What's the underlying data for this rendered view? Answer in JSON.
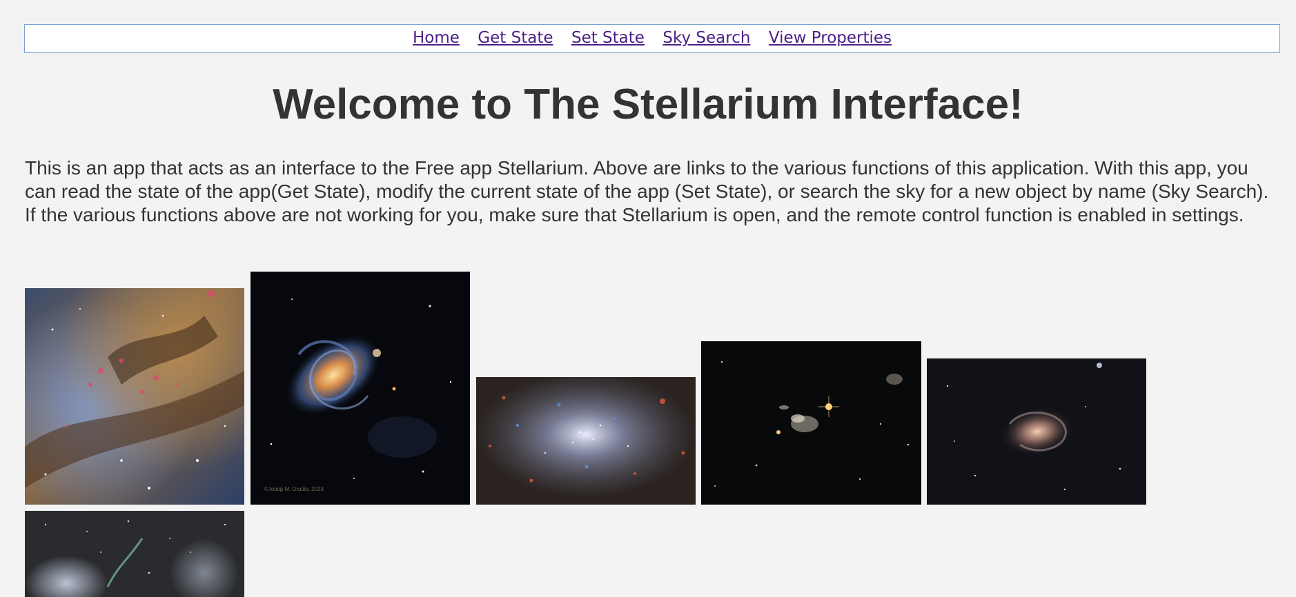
{
  "nav": {
    "links": [
      {
        "label": "Home"
      },
      {
        "label": "Get State"
      },
      {
        "label": "Set State"
      },
      {
        "label": "Sky Search"
      },
      {
        "label": "View Properties"
      }
    ]
  },
  "page": {
    "title": "Welcome to The Stellarium Interface!",
    "intro": "This is an app that acts as an interface to the Free app Stellarium. Above are links to the various functions of this application. With this app, you can read the state of the app(Get State), modify the current state of the app (Set State), or search the sky for a new object by name (Sky Search). If the various functions above are not working for you, make sure that Stellarium is open, and the remote control function is enabled in settings."
  },
  "gallery": {
    "images": [
      {
        "subject": "nebula-dust-clouds-image"
      },
      {
        "subject": "spiral-galaxy-image",
        "credit": "©Josep M. Drudis, 2023"
      },
      {
        "subject": "globular-cluster-image"
      },
      {
        "subject": "galaxy-group-image"
      },
      {
        "subject": "barred-spiral-galaxy-image"
      },
      {
        "subject": "comet-starfield-image"
      }
    ]
  }
}
